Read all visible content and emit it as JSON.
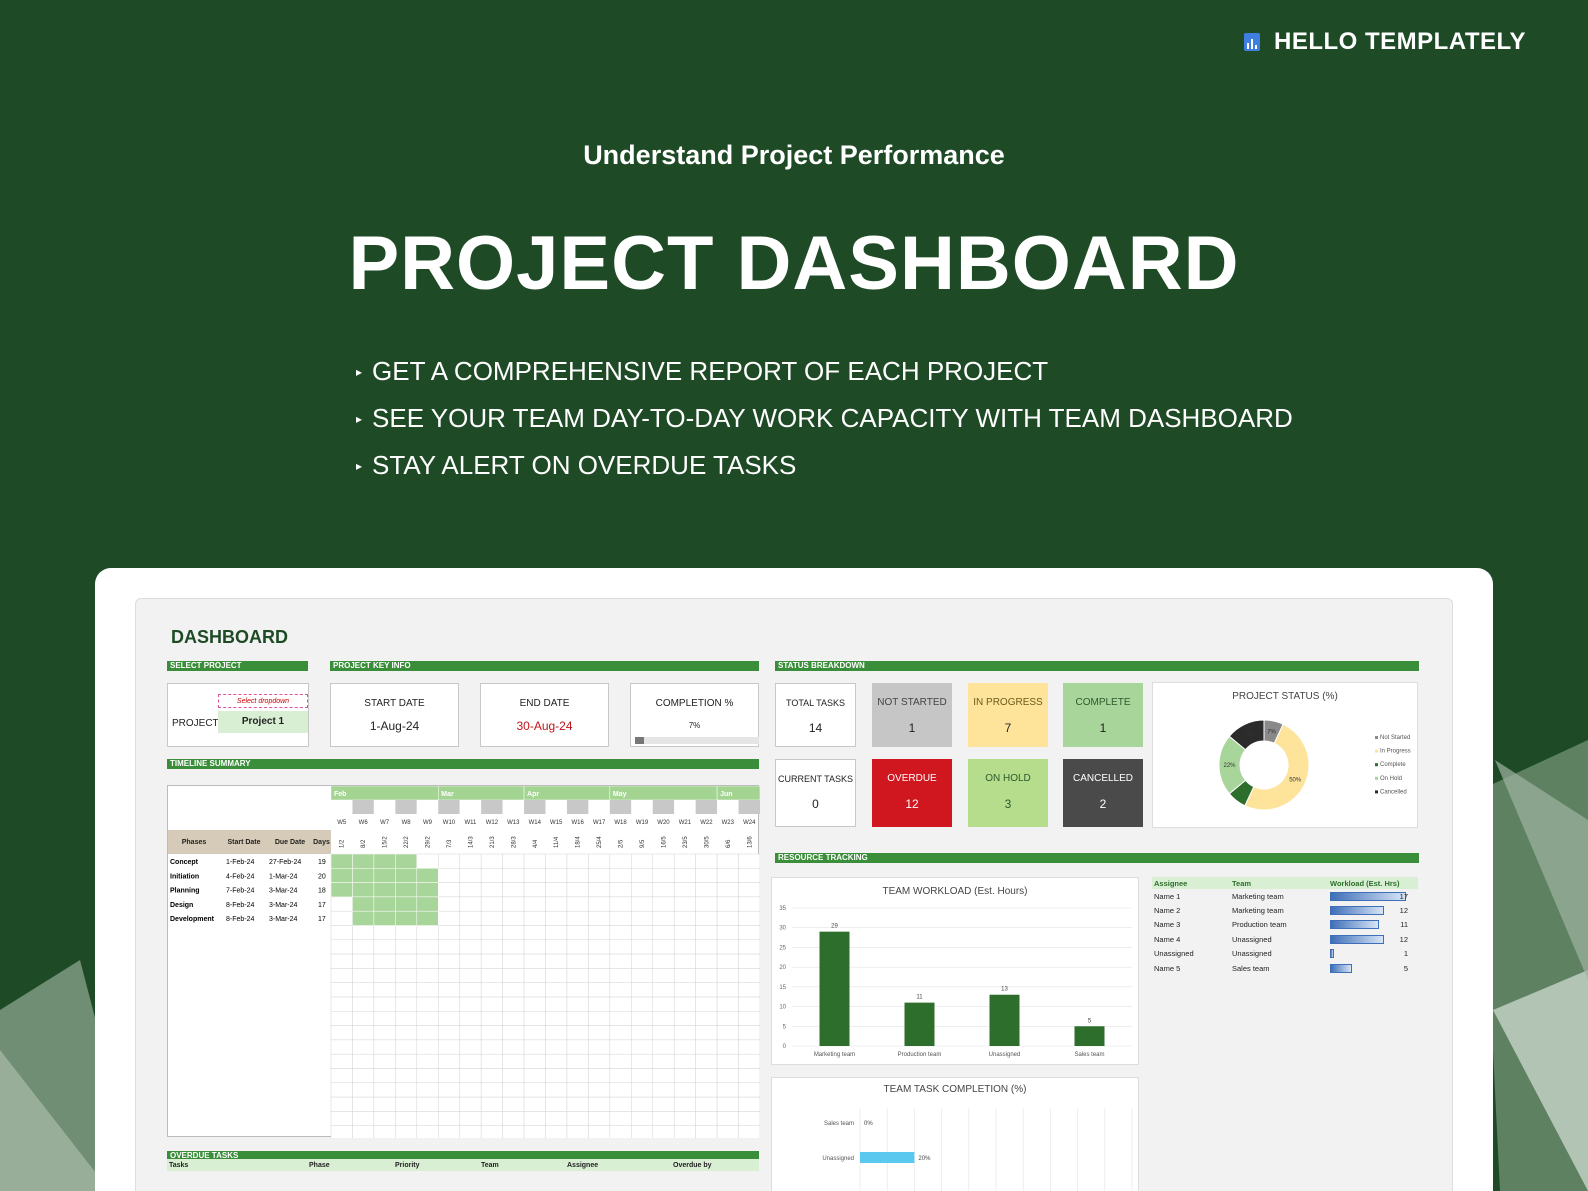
{
  "brand": {
    "name": "HELLO TEMPLATELY",
    "icon": "bar-chart-icon"
  },
  "tagline": "Understand Project Performance",
  "hero_title": "PROJECT DASHBOARD",
  "bullets": [
    "GET A COMPREHENSIVE REPORT OF EACH PROJECT",
    "SEE YOUR TEAM DAY-TO-DAY WORK CAPACITY WITH TEAM DASHBOARD",
    "STAY ALERT ON OVERDUE TASKS"
  ],
  "dashboard": {
    "title": "DASHBOARD",
    "sections": {
      "select_project": "SELECT PROJECT",
      "key_info": "PROJECT KEY INFO",
      "status_breakdown": "STATUS BREAKDOWN",
      "timeline_summary": "TIMELINE SUMMARY",
      "resource_tracking": "RESOURCE TRACKING",
      "overdue_tasks": "OVERDUE TASKS"
    },
    "select": {
      "label": "PROJECT",
      "hint": "Select dropdown",
      "value": "Project 1"
    },
    "key_info": {
      "start_label": "START DATE",
      "start_value": "1-Aug-24",
      "end_label": "END DATE",
      "end_value": "30-Aug-24",
      "completion_label": "COMPLETION %",
      "completion_value": "7%",
      "completion_fraction": 0.07
    },
    "status": {
      "total_label": "TOTAL TASKS",
      "total_value": "14",
      "not_started_label": "NOT STARTED",
      "not_started_value": "1",
      "in_progress_label": "IN PROGRESS",
      "in_progress_value": "7",
      "complete_label": "COMPLETE",
      "complete_value": "1",
      "current_label": "CURRENT TASKS",
      "current_value": "0",
      "overdue_label": "OVERDUE",
      "overdue_value": "12",
      "on_hold_label": "ON HOLD",
      "on_hold_value": "3",
      "cancelled_label": "CANCELLED",
      "cancelled_value": "2"
    },
    "colors": {
      "green_bar": "#3a8e3a",
      "not_started": "#c6c6c6",
      "in_progress": "#fde49a",
      "complete": "#a8d59a",
      "overdue": "#d0161e",
      "on_hold": "#b5dd8c",
      "cancelled": "#4a4a4a"
    },
    "timeline": {
      "headers": {
        "phases": "Phases",
        "start": "Start Date",
        "due": "Due Date",
        "days": "Days"
      },
      "months": [
        {
          "label": "Feb",
          "start": 0,
          "span": 5
        },
        {
          "label": "Mar",
          "start": 5,
          "span": 4
        },
        {
          "label": "Apr",
          "start": 9,
          "span": 4
        },
        {
          "label": "May",
          "start": 13,
          "span": 5
        },
        {
          "label": "Jun",
          "start": 18,
          "span": 2
        }
      ],
      "weeks": [
        "W5",
        "W6",
        "W7",
        "W8",
        "W9",
        "W10",
        "W11",
        "W12",
        "W13",
        "W14",
        "W15",
        "W16",
        "W17",
        "W18",
        "W19",
        "W20",
        "W21",
        "W22",
        "W23",
        "W24"
      ],
      "dates": [
        "1/2",
        "8/2",
        "15/2",
        "22/2",
        "29/2",
        "7/3",
        "14/3",
        "21/3",
        "28/3",
        "4/4",
        "11/4",
        "18/4",
        "25/4",
        "2/5",
        "9/5",
        "16/5",
        "23/5",
        "30/5",
        "6/6",
        "13/6"
      ],
      "phases": [
        {
          "name": "Concept",
          "start": "1-Feb-24",
          "due": "27-Feb-24",
          "days": "19",
          "from": 0,
          "to": 4
        },
        {
          "name": "Initiation",
          "start": "4-Feb-24",
          "due": "1-Mar-24",
          "days": "20",
          "from": 0,
          "to": 5
        },
        {
          "name": "Planning",
          "start": "7-Feb-24",
          "due": "3-Mar-24",
          "days": "18",
          "from": 0,
          "to": 5
        },
        {
          "name": "Design",
          "start": "8-Feb-24",
          "due": "3-Mar-24",
          "days": "17",
          "from": 1,
          "to": 5
        },
        {
          "name": "Development",
          "start": "8-Feb-24",
          "due": "3-Mar-24",
          "days": "17",
          "from": 1,
          "to": 5
        }
      ]
    },
    "resource_table": {
      "headers": {
        "assignee": "Assignee",
        "team": "Team",
        "workload": "Workload (Est. Hrs)"
      },
      "max": 17,
      "rows": [
        {
          "assignee": "Name 1",
          "team": "Marketing team",
          "hours": 17
        },
        {
          "assignee": "Name 2",
          "team": "Marketing team",
          "hours": 12
        },
        {
          "assignee": "Name 3",
          "team": "Production team",
          "hours": 11
        },
        {
          "assignee": "Name 4",
          "team": "Unassigned",
          "hours": 12
        },
        {
          "assignee": "Unassigned",
          "team": "Unassigned",
          "hours": 1
        },
        {
          "assignee": "Name 5",
          "team": "Sales team",
          "hours": 5
        }
      ]
    },
    "overdue_headers": [
      "Tasks",
      "Phase",
      "Priority",
      "Team",
      "Assignee",
      "Overdue by"
    ]
  },
  "chart_data": [
    {
      "type": "pie",
      "title": "PROJECT STATUS (%)",
      "categories": [
        "Not Started",
        "In Progress",
        "Complete",
        "On Hold",
        "Cancelled"
      ],
      "values": [
        7,
        50,
        7,
        22,
        14
      ],
      "labels": [
        "7%",
        "50%",
        "",
        "22%",
        "7%"
      ],
      "colors": [
        "#8a8a8a",
        "#fde49a",
        "#2d6e2d",
        "#a8d59a",
        "#2b2b2b"
      ],
      "legend": "right"
    },
    {
      "type": "bar",
      "title": "TEAM WORKLOAD (Est. Hours)",
      "categories": [
        "Marketing team",
        "Production team",
        "Unassigned",
        "Sales team"
      ],
      "values": [
        29,
        11,
        13,
        5
      ],
      "ylim": [
        0,
        35
      ],
      "yticks": [
        0,
        5,
        10,
        15,
        20,
        25,
        30,
        35
      ],
      "color": "#2d6e2d"
    },
    {
      "type": "bar",
      "orientation": "horizontal",
      "title": "TEAM TASK COMPLETION (%)",
      "categories": [
        "Sales team",
        "Unassigned"
      ],
      "values": [
        0,
        20
      ],
      "labels": [
        "0%",
        "20%"
      ],
      "color": "#5bc8ef"
    }
  ]
}
